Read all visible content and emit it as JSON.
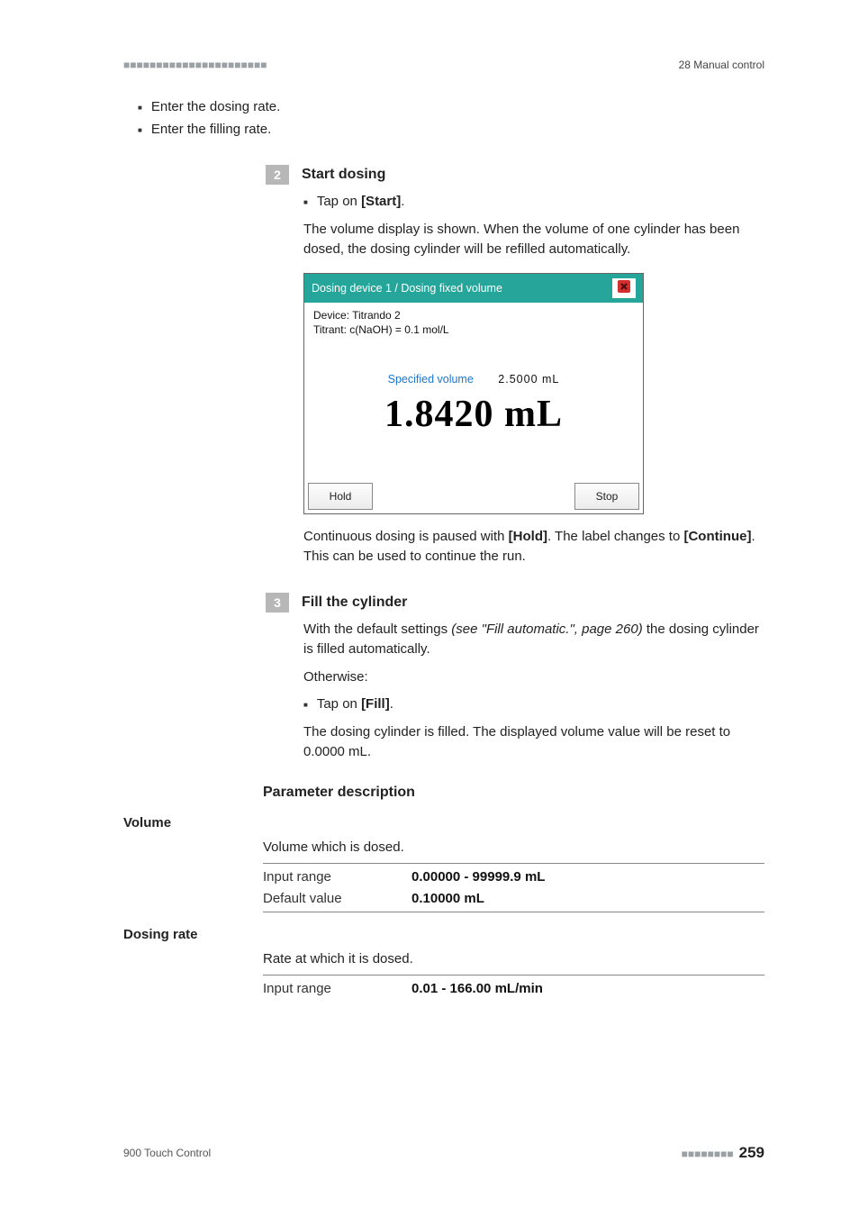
{
  "header": {
    "left_dashes": "■■■■■■■■■■■■■■■■■■■■■■",
    "right": "28 Manual control"
  },
  "bullets_top": [
    "Enter the dosing rate.",
    "Enter the filling rate."
  ],
  "step2": {
    "num": "2",
    "title": "Start dosing",
    "bullet_prefix": "Tap on ",
    "bullet_bold": "[Start]",
    "bullet_suffix": ".",
    "para": "The volume display is shown. When the volume of one cylinder has been dosed, the dosing cylinder will be refilled automatically."
  },
  "screenshot": {
    "title": "Dosing device 1 / Dosing fixed volume",
    "device": "Device: Titrando 2",
    "titrant": "Titrant: c(NaOH) = 0.1 mol/L",
    "specvol_label": "Specified volume",
    "specvol_value": "2.5000  mL",
    "bignum": "1.8420 mL",
    "hold_btn": "Hold",
    "stop_btn": "Stop"
  },
  "step2_after": {
    "prefix": "Continuous dosing is paused with ",
    "hold": "[Hold]",
    "mid": ". The label changes to ",
    "cont": "[Continue]",
    "suffix": ". This can be used to continue the run."
  },
  "step3": {
    "num": "3",
    "title": "Fill the cylinder",
    "line1_prefix": "With the default settings ",
    "line1_ref": "(see \"Fill automatic.\", page 260)",
    "line1_suffix": " the dosing cylinder is filled automatically.",
    "otherwise": "Otherwise:",
    "bullet_prefix": "Tap on ",
    "bullet_bold": "[Fill]",
    "bullet_suffix": ".",
    "after": "The dosing cylinder is filled. The displayed volume value will be reset to 0.0000 mL."
  },
  "params": {
    "sec_title": "Parameter description",
    "volume": {
      "name": "Volume",
      "desc": "Volume which is dosed.",
      "rows": [
        {
          "k": "Input range",
          "v": "0.00000 - 99999.9 mL"
        },
        {
          "k": "Default value",
          "v": "0.10000 mL"
        }
      ]
    },
    "dosing_rate": {
      "name": "Dosing rate",
      "desc": "Rate at which it is dosed.",
      "rows": [
        {
          "k": "Input range",
          "v": "0.01 - 166.00 mL/min"
        }
      ]
    }
  },
  "footer": {
    "left": "900 Touch Control",
    "dashes": "■■■■■■■■",
    "page": "259"
  }
}
